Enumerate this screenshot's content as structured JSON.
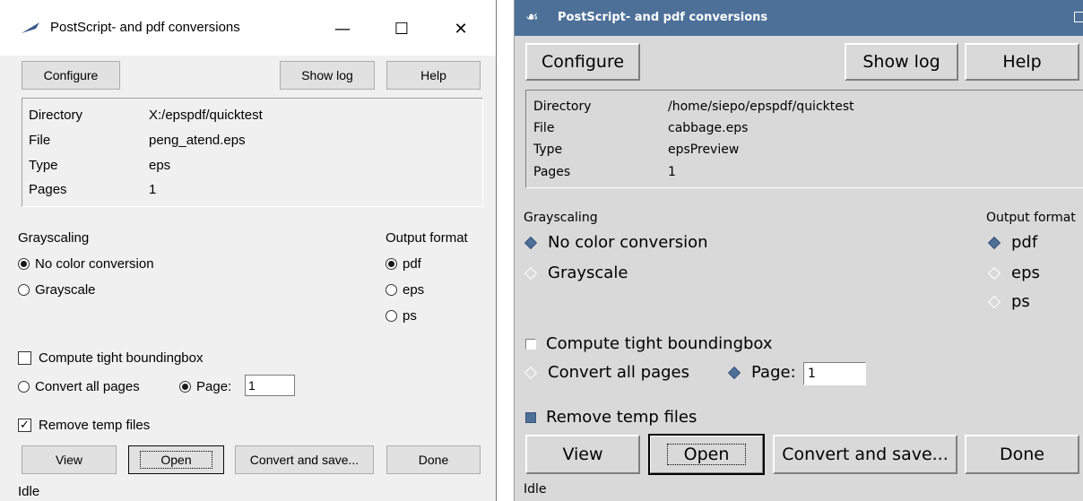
{
  "windows_panel": {
    "title": "PostScript- and pdf conversions",
    "controls": {
      "minimize": "—",
      "maximize": "☐",
      "close": "✕"
    },
    "buttons": {
      "configure": "Configure",
      "show_log": "Show log",
      "help": "Help"
    },
    "info": [
      {
        "label": "Directory",
        "value": "X:/epspdf/quicktest"
      },
      {
        "label": "File",
        "value": "peng_atend.eps"
      },
      {
        "label": "Type",
        "value": "eps"
      },
      {
        "label": "Pages",
        "value": "1"
      }
    ],
    "grayscaling": {
      "heading": "Grayscaling",
      "no_color": "No color conversion",
      "grayscale": "Grayscale",
      "selected": "no_color"
    },
    "output": {
      "heading": "Output format",
      "pdf": "pdf",
      "eps": "eps",
      "ps": "ps",
      "selected": "pdf"
    },
    "options": {
      "bbox": "Compute tight boundingbox",
      "bbox_checked": false,
      "all_pages": "Convert all pages",
      "page": "Page:",
      "page_value": "1",
      "page_selected": true,
      "remove_temp": "Remove temp files",
      "remove_temp_checked": true
    },
    "actions": {
      "view": "View",
      "open": "Open",
      "convert": "Convert and save...",
      "done": "Done"
    },
    "status": "Idle"
  },
  "tk_panel": {
    "title": "PostScript- and pdf conversions",
    "buttons": {
      "configure": "Configure",
      "show_log": "Show log",
      "help": "Help"
    },
    "info": [
      {
        "label": "Directory",
        "value": "/home/siepo/epspdf/quicktest"
      },
      {
        "label": "File",
        "value": "cabbage.eps"
      },
      {
        "label": "Type",
        "value": "epsPreview"
      },
      {
        "label": "Pages",
        "value": "1"
      }
    ],
    "grayscaling": {
      "heading": "Grayscaling",
      "no_color": "No color conversion",
      "grayscale": "Grayscale",
      "selected": "no_color"
    },
    "output": {
      "heading": "Output format",
      "pdf": "pdf",
      "eps": "eps",
      "ps": "ps",
      "selected": "pdf"
    },
    "options": {
      "bbox": "Compute tight boundingbox",
      "bbox_checked": false,
      "all_pages": "Convert all pages",
      "page": "Page:",
      "page_value": "1",
      "page_selected": true,
      "remove_temp": "Remove temp files",
      "remove_temp_checked": true
    },
    "actions": {
      "view": "View",
      "open": "Open",
      "convert": "Convert and save...",
      "done": "Done"
    },
    "status": "Idle"
  },
  "colors": {
    "tk_accent": "#4d7099",
    "win_bg": "#f0f0f0",
    "tk_bg": "#d9d9d9"
  }
}
